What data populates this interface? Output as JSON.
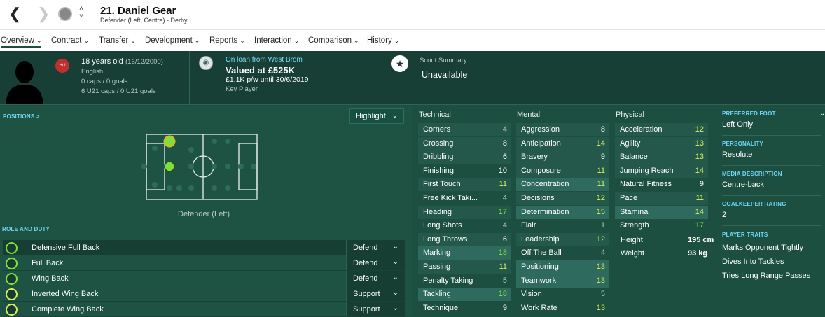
{
  "header": {
    "name": "21. Daniel Gear",
    "subtitle": "Defender (Left, Centre) - Derby"
  },
  "tabs": [
    "Overview",
    "Contract",
    "Transfer",
    "Development",
    "Reports",
    "Interaction",
    "Comparison",
    "History"
  ],
  "info": {
    "flag": "Hol",
    "age": "18 years old",
    "dob": "(16/12/2000)",
    "nationality": "English",
    "caps": "0 caps / 0 goals",
    "u21": "6 U21 caps / 0 U21 goals",
    "loan": "On loan from West Brom",
    "value": "Valued at £525K",
    "wage": "£1.1K p/w until 30/6/2019",
    "status": "Key Player",
    "scout_label": "Scout Summary",
    "scout_value": "Unavailable"
  },
  "positions": {
    "label": "POSITIONS >",
    "highlight": "Highlight",
    "position_name": "Defender (Left)"
  },
  "roles": {
    "label": "ROLE AND DUTY",
    "items": [
      {
        "name": "Defensive Full Back",
        "duty": "Defend"
      },
      {
        "name": "Full Back",
        "duty": "Defend"
      },
      {
        "name": "Wing Back",
        "duty": "Defend"
      },
      {
        "name": "Inverted Wing Back",
        "duty": "Support"
      },
      {
        "name": "Complete Wing Back",
        "duty": "Support"
      }
    ]
  },
  "technical": {
    "title": "Technical",
    "items": [
      {
        "n": "Corners",
        "v": "4"
      },
      {
        "n": "Crossing",
        "v": "8"
      },
      {
        "n": "Dribbling",
        "v": "6"
      },
      {
        "n": "Finishing",
        "v": "10"
      },
      {
        "n": "First Touch",
        "v": "11"
      },
      {
        "n": "Free Kick Taki...",
        "v": "4"
      },
      {
        "n": "Heading",
        "v": "17"
      },
      {
        "n": "Long Shots",
        "v": "4"
      },
      {
        "n": "Long Throws",
        "v": "6"
      },
      {
        "n": "Marking",
        "v": "18"
      },
      {
        "n": "Passing",
        "v": "11"
      },
      {
        "n": "Penalty Taking",
        "v": "5"
      },
      {
        "n": "Tackling",
        "v": "18"
      },
      {
        "n": "Technique",
        "v": "9"
      }
    ]
  },
  "mental": {
    "title": "Mental",
    "items": [
      {
        "n": "Aggression",
        "v": "8"
      },
      {
        "n": "Anticipation",
        "v": "14"
      },
      {
        "n": "Bravery",
        "v": "9"
      },
      {
        "n": "Composure",
        "v": "11"
      },
      {
        "n": "Concentration",
        "v": "11"
      },
      {
        "n": "Decisions",
        "v": "12"
      },
      {
        "n": "Determination",
        "v": "15"
      },
      {
        "n": "Flair",
        "v": "1"
      },
      {
        "n": "Leadership",
        "v": "12"
      },
      {
        "n": "Off The Ball",
        "v": "4"
      },
      {
        "n": "Positioning",
        "v": "13"
      },
      {
        "n": "Teamwork",
        "v": "13"
      },
      {
        "n": "Vision",
        "v": "5"
      },
      {
        "n": "Work Rate",
        "v": "13"
      }
    ]
  },
  "physical": {
    "title": "Physical",
    "items": [
      {
        "n": "Acceleration",
        "v": "12"
      },
      {
        "n": "Agility",
        "v": "13"
      },
      {
        "n": "Balance",
        "v": "13"
      },
      {
        "n": "Jumping Reach",
        "v": "14"
      },
      {
        "n": "Natural Fitness",
        "v": "9"
      },
      {
        "n": "Pace",
        "v": "11"
      },
      {
        "n": "Stamina",
        "v": "14"
      },
      {
        "n": "Strength",
        "v": "17"
      }
    ],
    "height_label": "Height",
    "height": "195 cm",
    "weight_label": "Weight",
    "weight": "93 kg"
  },
  "side": {
    "foot_label": "PREFERRED FOOT",
    "foot": "Left Only",
    "pers_label": "PERSONALITY",
    "pers": "Resolute",
    "media_label": "MEDIA DESCRIPTION",
    "media": "Centre-back",
    "gk_label": "GOALKEEPER RATING",
    "gk": "2",
    "traits_label": "PLAYER TRAITS",
    "traits": [
      "Marks Opponent Tightly",
      "Dives Into Tackles",
      "Tries Long Range Passes"
    ]
  },
  "colors": {
    "green": "#7ee03b",
    "yellow": "#d6ef5c",
    "grey": "#b9c9c4",
    "accent": "#6fd6f5"
  }
}
